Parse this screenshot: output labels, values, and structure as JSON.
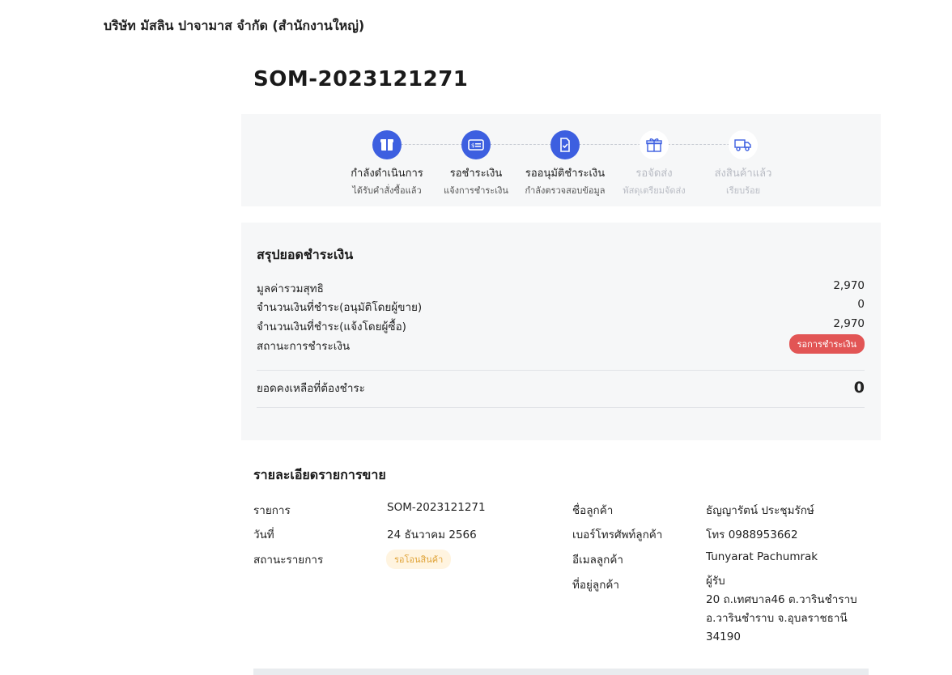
{
  "company_name": "บริษัท มัสลิน ปาจามาส จำกัด (สำนักงานใหญ่)",
  "order_number": "SOM-2023121271",
  "progress": {
    "steps": [
      {
        "title": "กำลังดำเนินการ",
        "subtitle": "ได้รับคำสั่งซื้อแล้ว",
        "icon": "box-icon",
        "active": true
      },
      {
        "title": "รอชำระเงิน",
        "subtitle": "แจ้งการชำระเงิน",
        "icon": "payment-card-icon",
        "active": true
      },
      {
        "title": "รออนุมัติชำระเงิน",
        "subtitle": "กำลังตรวจสอบข้อมูล",
        "icon": "document-check-icon",
        "active": true
      },
      {
        "title": "รอจัดส่ง",
        "subtitle": "พัสดุเตรียมจัดส่ง",
        "icon": "gift-box-icon",
        "active": false
      },
      {
        "title": "ส่งสินค้าแล้ว",
        "subtitle": "เรียบร้อย",
        "icon": "truck-icon",
        "active": false
      }
    ],
    "active_color": "#3d5fe0"
  },
  "summary": {
    "heading": "สรุปยอดชำระเงิน",
    "net_total_label": "มูลค่ารวมสุทธิ",
    "net_total_value": "2,970",
    "paid_approved_label": "จำนวนเงินที่ชำระ(อนุมัติโดยผู้ขาย)",
    "paid_approved_value": "0",
    "paid_reported_label": "จำนวนเงินที่ชำระ(แจ้งโดยผู้ซื้อ)",
    "paid_reported_value": "2,970",
    "payment_status_label": "สถานะการชำระเงิน",
    "payment_status_badge": "รอการชำระเงิน",
    "balance_label": "ยอดคงเหลือที่ต้องชำระ",
    "balance_value": "0"
  },
  "details": {
    "heading": "รายละเอียดรายการขาย",
    "item_label": "รายการ",
    "item_value": "SOM-2023121271",
    "date_label": "วันที่",
    "date_value": "24 ธันวาคม 2566",
    "status_label": "สถานะรายการ",
    "status_badge": "รอโอนสินค้า",
    "customer_name_label": "ชื่อลูกค้า",
    "customer_name_value": "ธัญญารัตน์ ประชุมรักษ์",
    "phone_label": "เบอร์โทรศัพท์ลูกค้า",
    "phone_value": "โทร 0988953662",
    "email_label": "อีเมลลูกค้า",
    "email_value": "Tunyarat Pachumrak",
    "address_label": "ที่อยู่ลูกค้า",
    "address_lines": [
      "ผู้รับ",
      "20 ถ.เทศบาล46 ต.วารินชำราบ",
      "อ.วารินชำราบ จ.อุบลราชธานี",
      "34190"
    ]
  }
}
